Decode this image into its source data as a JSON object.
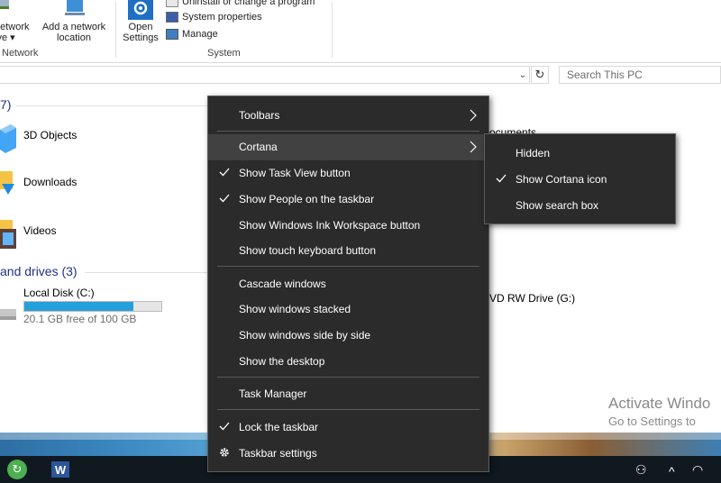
{
  "ribbon": {
    "map_drive_label_1": "network",
    "map_drive_label_2": "ive ▾",
    "add_location_label_1": "Add a network",
    "add_location_label_2": "location",
    "network_group": "Network",
    "open_settings_1": "Open",
    "open_settings_2": "Settings",
    "uninstall_label": "Uninstall or change a program",
    "system_properties_label": "System properties",
    "manage_label": "Manage",
    "system_group": "System"
  },
  "toolbar": {
    "search_placeholder": "Search This PC",
    "refresh_glyph": "↻",
    "dropdown_glyph": "⌄"
  },
  "content": {
    "folders_count_fragment": "7)",
    "folders": [
      {
        "label": "3D Objects"
      },
      {
        "label": "Downloads"
      },
      {
        "label": "Videos"
      }
    ],
    "documents_fragment": "ocuments",
    "drives_header": "and drives (3)",
    "drive_c": {
      "label": "Local Disk (C:)",
      "free_text": "20.1 GB free of 100 GB",
      "used_fraction": 0.799
    },
    "dvd_drive_label": "VD RW Drive (G:)"
  },
  "watermark": {
    "line1": "Activate Windo",
    "line2": "Go to Settings to"
  },
  "context_menu": {
    "items": [
      {
        "label": "Toolbars",
        "checked": false,
        "submenu": true
      },
      {
        "label": "Cortana",
        "checked": false,
        "submenu": true
      },
      {
        "label": "Show Task View button",
        "checked": true
      },
      {
        "label": "Show People on the taskbar",
        "checked": true
      },
      {
        "label": "Show Windows Ink Workspace button",
        "checked": false
      },
      {
        "label": "Show touch keyboard button",
        "checked": false
      },
      {
        "label": "Cascade windows",
        "checked": false
      },
      {
        "label": "Show windows stacked",
        "checked": false
      },
      {
        "label": "Show windows side by side",
        "checked": false
      },
      {
        "label": "Show the desktop",
        "checked": false
      },
      {
        "label": "Task Manager",
        "checked": false
      },
      {
        "label": "Lock the taskbar",
        "checked": true
      },
      {
        "label": "Taskbar settings",
        "checked": false,
        "icon": "gear-icon"
      }
    ]
  },
  "cortana_submenu": {
    "items": [
      {
        "label": "Hidden",
        "checked": false
      },
      {
        "label": "Show Cortana icon",
        "checked": true
      },
      {
        "label": "Show search box",
        "checked": false
      }
    ]
  },
  "taskbar": {
    "word_glyph": "W",
    "app_glyph": "↻",
    "people_glyph": "⚇",
    "chevron_glyph": "^",
    "wifi_glyph": "◠"
  },
  "colors": {
    "menu_bg": "#2b2b2b",
    "menu_highlight": "#414141",
    "accent_blue": "#26a0da",
    "header_blue": "#1e3287"
  }
}
